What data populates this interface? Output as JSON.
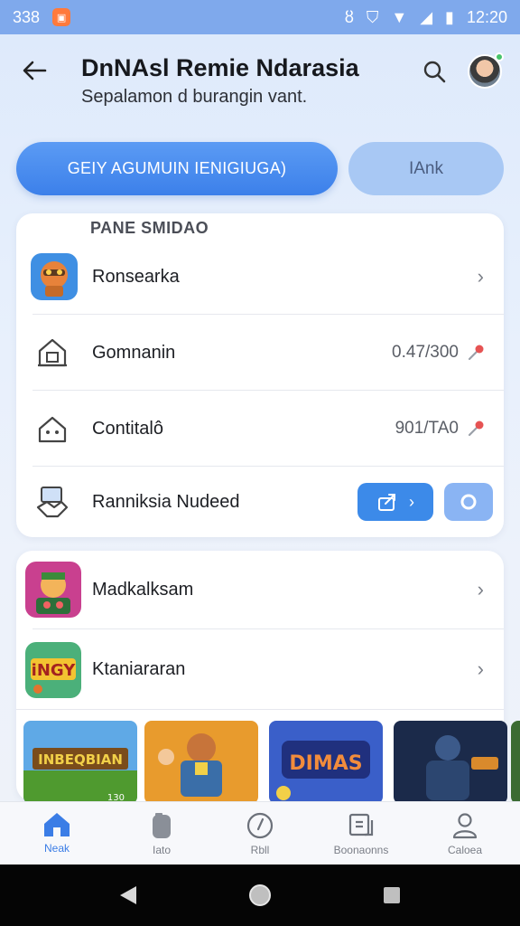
{
  "status_bar": {
    "left_text": "338",
    "time": "12:20"
  },
  "header": {
    "title": "DnNAsl Remie Ndarasia",
    "subtitle": "Sepalamon d burangin vant."
  },
  "actions": {
    "primary_label": "GEIY AGUMUIN IENIGIUGA)",
    "secondary_label": "IAnk"
  },
  "section1": {
    "title": "PANE SMIDAO",
    "rows": [
      {
        "label": "Ronsearka"
      },
      {
        "label": "Gomnanin",
        "value": "0.47/300"
      },
      {
        "label": "Contitalô",
        "value": "901/TA0"
      },
      {
        "label": "Ranniksia Nudeed"
      }
    ]
  },
  "section2": {
    "rows": [
      {
        "label": "Madkalksam"
      },
      {
        "label": "Ktaniararan"
      }
    ],
    "thumbnails": [
      {
        "title": "INBEQBIAN",
        "badge": "130"
      },
      {
        "title": ""
      },
      {
        "title": "DIMAS"
      },
      {
        "title": ""
      }
    ]
  },
  "tabs": [
    {
      "label": "Neak",
      "icon": "home-icon",
      "active": true
    },
    {
      "label": "Iato",
      "icon": "device-icon",
      "active": false
    },
    {
      "label": "Rbll",
      "icon": "compass-icon",
      "active": false
    },
    {
      "label": "Boonaonns",
      "icon": "book-icon",
      "active": false
    },
    {
      "label": "Caloea",
      "icon": "person-icon",
      "active": false
    }
  ],
  "colors": {
    "accent": "#3c80ea",
    "status_bar": "#7fa9ec",
    "secondary": "#a8c8f4"
  }
}
